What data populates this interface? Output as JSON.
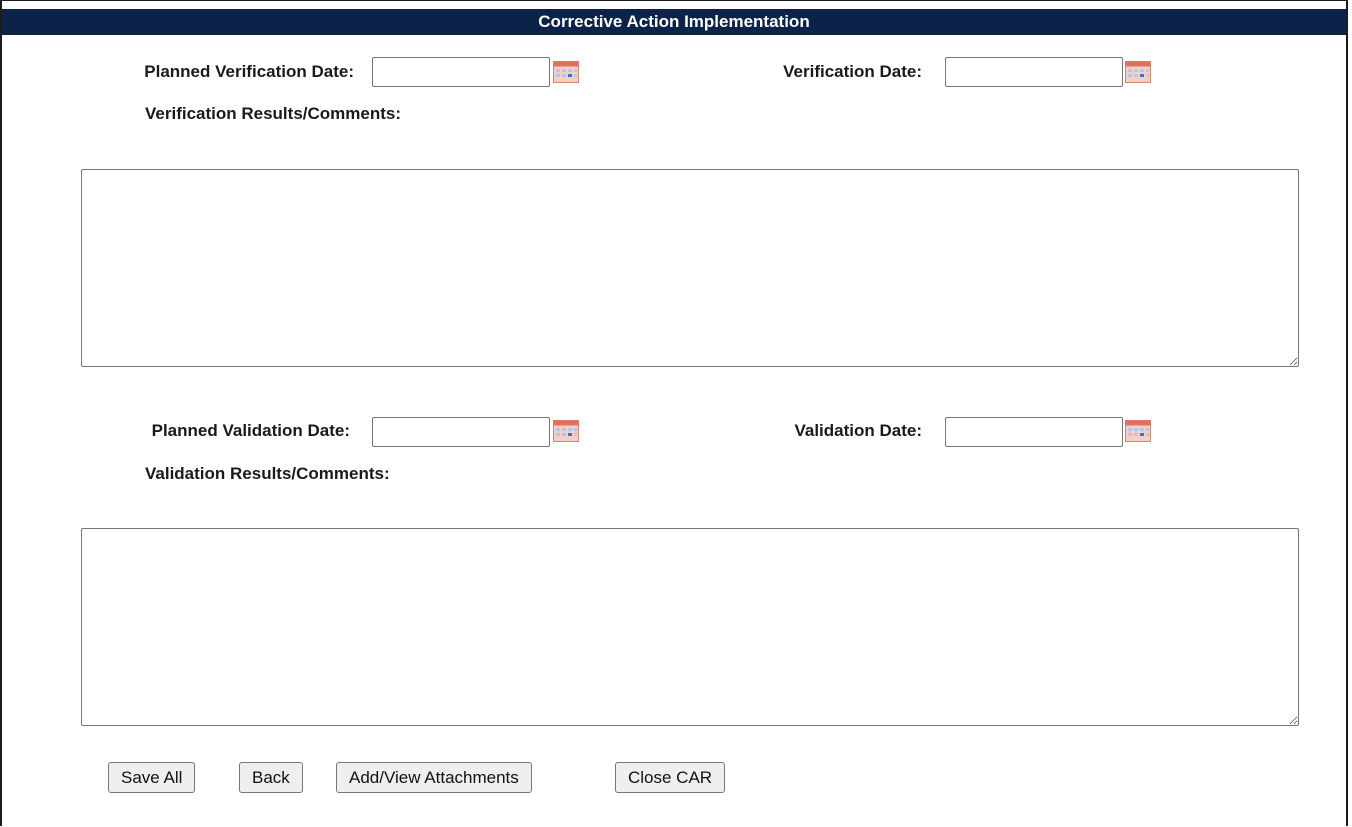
{
  "section": {
    "title": "Corrective Action Implementation"
  },
  "verification": {
    "planned_date_label": "Planned Verification Date:",
    "planned_date_value": "",
    "date_label": "Verification Date:",
    "date_value": "",
    "comments_label": "Verification Results/Comments:",
    "comments_value": ""
  },
  "validation": {
    "planned_date_label": "Planned Validation Date:",
    "planned_date_value": "",
    "date_label": "Validation Date:",
    "date_value": "",
    "comments_label": "Validation Results/Comments:",
    "comments_value": ""
  },
  "buttons": {
    "save_all": "Save All",
    "back": "Back",
    "attachments": "Add/View Attachments",
    "close_car": "Close CAR"
  },
  "colors": {
    "header_bg": "#0b2349",
    "header_text": "#ffffff",
    "calendar_icon": "#e0705d"
  },
  "icons": {
    "calendar": "calendar-icon"
  }
}
